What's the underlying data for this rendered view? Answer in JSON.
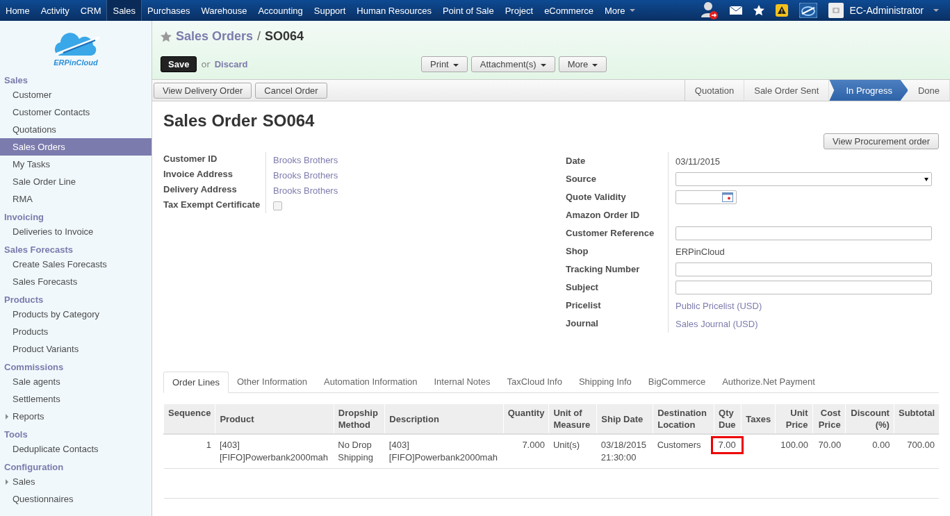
{
  "topnav": {
    "items": [
      {
        "label": "Home",
        "selected": false
      },
      {
        "label": "Activity",
        "selected": false
      },
      {
        "label": "CRM",
        "selected": false
      },
      {
        "label": "Sales",
        "selected": true
      },
      {
        "label": "Purchases",
        "selected": false
      },
      {
        "label": "Warehouse",
        "selected": false
      },
      {
        "label": "Accounting",
        "selected": false
      },
      {
        "label": "Support",
        "selected": false
      },
      {
        "label": "Human Resources",
        "selected": false
      },
      {
        "label": "Point of Sale",
        "selected": false
      },
      {
        "label": "Project",
        "selected": false
      },
      {
        "label": "eCommerce",
        "selected": false
      },
      {
        "label": "More",
        "selected": false
      }
    ],
    "user": "EC-Administrator"
  },
  "sidebar": {
    "logo_text": "ERPinCloud",
    "sections": [
      {
        "title": "Sales",
        "items": [
          {
            "label": "Customer",
            "selected": false,
            "expandable": false
          },
          {
            "label": "Customer Contacts",
            "selected": false,
            "expandable": false
          },
          {
            "label": "Quotations",
            "selected": false,
            "expandable": false
          },
          {
            "label": "Sales Orders",
            "selected": true,
            "expandable": false
          },
          {
            "label": "My Tasks",
            "selected": false,
            "expandable": false
          },
          {
            "label": "Sale Order Line",
            "selected": false,
            "expandable": false
          },
          {
            "label": "RMA",
            "selected": false,
            "expandable": false
          }
        ]
      },
      {
        "title": "Invoicing",
        "items": [
          {
            "label": "Deliveries to Invoice",
            "selected": false,
            "expandable": false
          }
        ]
      },
      {
        "title": "Sales Forecasts",
        "items": [
          {
            "label": "Create Sales Forecasts",
            "selected": false,
            "expandable": false
          },
          {
            "label": "Sales Forecasts",
            "selected": false,
            "expandable": false
          }
        ]
      },
      {
        "title": "Products",
        "items": [
          {
            "label": "Products by Category",
            "selected": false,
            "expandable": false
          },
          {
            "label": "Products",
            "selected": false,
            "expandable": false
          },
          {
            "label": "Product Variants",
            "selected": false,
            "expandable": false
          }
        ]
      },
      {
        "title": "Commissions",
        "items": [
          {
            "label": "Sale agents",
            "selected": false,
            "expandable": false
          },
          {
            "label": "Settlements",
            "selected": false,
            "expandable": false
          },
          {
            "label": "Reports",
            "selected": false,
            "expandable": true
          }
        ]
      },
      {
        "title": "Tools",
        "items": [
          {
            "label": "Deduplicate Contacts",
            "selected": false,
            "expandable": false
          }
        ]
      },
      {
        "title": "Configuration",
        "items": [
          {
            "label": "Sales",
            "selected": false,
            "expandable": true
          },
          {
            "label": "Questionnaires",
            "selected": false,
            "expandable": false
          }
        ]
      }
    ]
  },
  "header": {
    "breadcrumb": "Sales Orders",
    "separator": "/",
    "record": "SO064",
    "save": "Save",
    "or": "or",
    "discard": "Discard",
    "menus": [
      "Print",
      "Attachment(s)",
      "More"
    ]
  },
  "statusbar": {
    "buttons": [
      "View Delivery Order",
      "Cancel Order"
    ],
    "steps": [
      {
        "label": "Quotation",
        "selected": false
      },
      {
        "label": "Sale Order Sent",
        "selected": false
      },
      {
        "label": "In Progress",
        "selected": true
      },
      {
        "label": "Done",
        "selected": false
      }
    ]
  },
  "form": {
    "title": "Sales Order",
    "number": "SO064",
    "procurement_button": "View Procurement order",
    "left_fields": [
      {
        "label": "Customer ID",
        "kind": "link",
        "value": "Brooks Brothers"
      },
      {
        "label": "Invoice Address",
        "kind": "link",
        "value": "Brooks Brothers"
      },
      {
        "label": "Delivery Address",
        "kind": "link",
        "value": "Brooks Brothers"
      },
      {
        "label": "Tax Exempt Certificate",
        "kind": "checkbox",
        "checked": false
      }
    ],
    "right_fields": [
      {
        "label": "Date",
        "kind": "text",
        "value": "03/11/2015"
      },
      {
        "label": "Source",
        "kind": "select"
      },
      {
        "label": "Quote Validity",
        "kind": "date"
      },
      {
        "label": "Amazon Order ID",
        "kind": "empty"
      },
      {
        "label": "Customer Reference",
        "kind": "input"
      },
      {
        "label": "Shop",
        "kind": "text",
        "value": "ERPinCloud"
      },
      {
        "label": "Tracking Number",
        "kind": "input"
      },
      {
        "label": "Subject",
        "kind": "input"
      },
      {
        "label": "Pricelist",
        "kind": "link",
        "value": "Public Pricelist (USD)"
      },
      {
        "label": "Journal",
        "kind": "link",
        "value": "Sales Journal (USD)"
      }
    ]
  },
  "tabs": [
    {
      "label": "Order Lines",
      "selected": true
    },
    {
      "label": "Other Information",
      "selected": false
    },
    {
      "label": "Automation Information",
      "selected": false
    },
    {
      "label": "Internal Notes",
      "selected": false
    },
    {
      "label": "TaxCloud Info",
      "selected": false
    },
    {
      "label": "Shipping Info",
      "selected": false
    },
    {
      "label": "BigCommerce",
      "selected": false
    },
    {
      "label": "Authorize.Net Payment",
      "selected": false
    }
  ],
  "table": {
    "columns": [
      {
        "label": "Sequence",
        "numeric": true
      },
      {
        "label": "Product",
        "numeric": false
      },
      {
        "label": "Dropship Method",
        "numeric": false
      },
      {
        "label": "Description",
        "numeric": false
      },
      {
        "label": "Quantity",
        "numeric": true
      },
      {
        "label": "Unit of Measure",
        "numeric": false
      },
      {
        "label": "Ship Date",
        "numeric": false
      },
      {
        "label": "Destination Location",
        "numeric": false
      },
      {
        "label": "Qty Due",
        "numeric": false
      },
      {
        "label": "Taxes",
        "numeric": false
      },
      {
        "label": "Unit Price",
        "numeric": true
      },
      {
        "label": "Cost Price",
        "numeric": true
      },
      {
        "label": "Discount (%)",
        "numeric": true
      },
      {
        "label": "Subtotal",
        "numeric": true
      }
    ],
    "rows": [
      {
        "cells": [
          {
            "text": "1",
            "highlighted": false
          },
          {
            "text": "[403] [FIFO]Powerbank2000mah",
            "highlighted": false
          },
          {
            "text": "No Drop Shipping",
            "highlighted": false
          },
          {
            "text": "[403] [FIFO]Powerbank2000mah",
            "highlighted": false
          },
          {
            "text": "7.000",
            "highlighted": false
          },
          {
            "text": "Unit(s)",
            "highlighted": false
          },
          {
            "text": "03/18/2015 21:30:00",
            "highlighted": false
          },
          {
            "text": "Customers",
            "highlighted": false
          },
          {
            "text": "7.00",
            "highlighted": true
          },
          {
            "highlighted": false
          },
          {
            "text": "100.00",
            "highlighted": false
          },
          {
            "text": "70.00",
            "highlighted": false
          },
          {
            "text": "0.00",
            "highlighted": false
          },
          {
            "text": "700.00",
            "highlighted": false
          }
        ]
      }
    ]
  }
}
